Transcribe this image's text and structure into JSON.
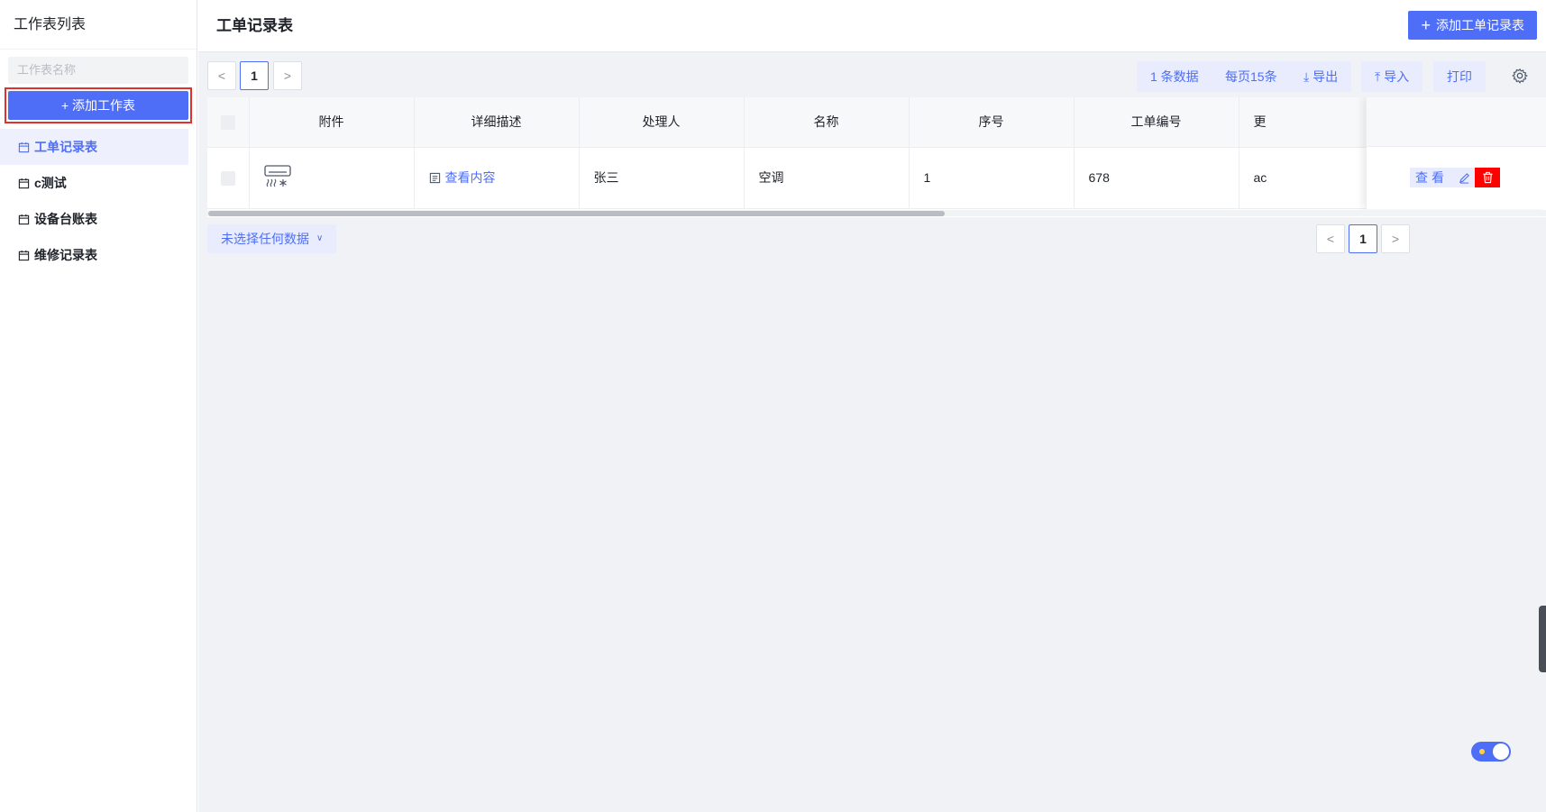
{
  "sidebar": {
    "title": "工作表列表",
    "search_placeholder": "工作表名称",
    "add_button": "+ 添加工作表",
    "items": [
      {
        "label": "工单记录表"
      },
      {
        "label": "c测试"
      },
      {
        "label": "设备台账表"
      },
      {
        "label": "维修记录表"
      }
    ]
  },
  "header": {
    "title": "工单记录表",
    "add_button": "添加工单记录表"
  },
  "toolbar": {
    "page": "1",
    "prev": "<",
    "next": ">",
    "count": "1 条数据",
    "page_size": "每页15条",
    "export": "导出",
    "import": "导入",
    "print": "打印"
  },
  "table": {
    "columns": [
      "附件",
      "详细描述",
      "处理人",
      "名称",
      "序号",
      "工单编号",
      "更"
    ],
    "rows": [
      {
        "description_link": "查看内容",
        "handler": "张三",
        "name": "空调",
        "seq": "1",
        "order_no": "678",
        "more": "ac"
      }
    ],
    "actions": {
      "view": "查看"
    }
  },
  "footer": {
    "selection": "未选择任何数据",
    "page": "1",
    "prev": "<",
    "next": ">"
  },
  "colors": {
    "accent": "#4f6ef7",
    "danger": "#ff0000",
    "highlight_border": "#e03131"
  }
}
